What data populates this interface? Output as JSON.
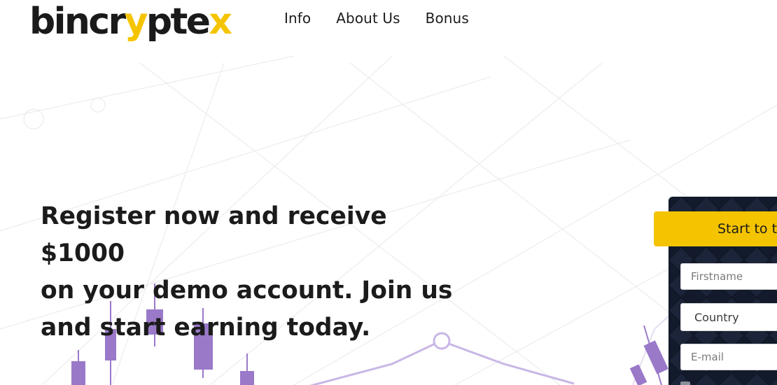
{
  "brand": {
    "wordmark_dark": "bincr",
    "wordmark_y": "y",
    "wordmark_dark2": "pte",
    "wordmark_x": "x",
    "color_dark": "#1a1a1a",
    "color_accent": "#f5c400"
  },
  "nav": {
    "items": [
      {
        "label": "Info"
      },
      {
        "label": "About Us"
      },
      {
        "label": "Bonus"
      }
    ]
  },
  "hero": {
    "line1": "Register now and receive $1000",
    "line2": "on your demo account. Join us",
    "line3": "and start earning today."
  },
  "form": {
    "cta_label": "Start to trade",
    "firstname_placeholder": "Firstname",
    "country_label": "Country",
    "email_placeholder": "E-mail"
  },
  "colors": {
    "panel_bg": "#121a2b",
    "cta_bg": "#f5c400",
    "candle_purple": "#9370c6"
  }
}
